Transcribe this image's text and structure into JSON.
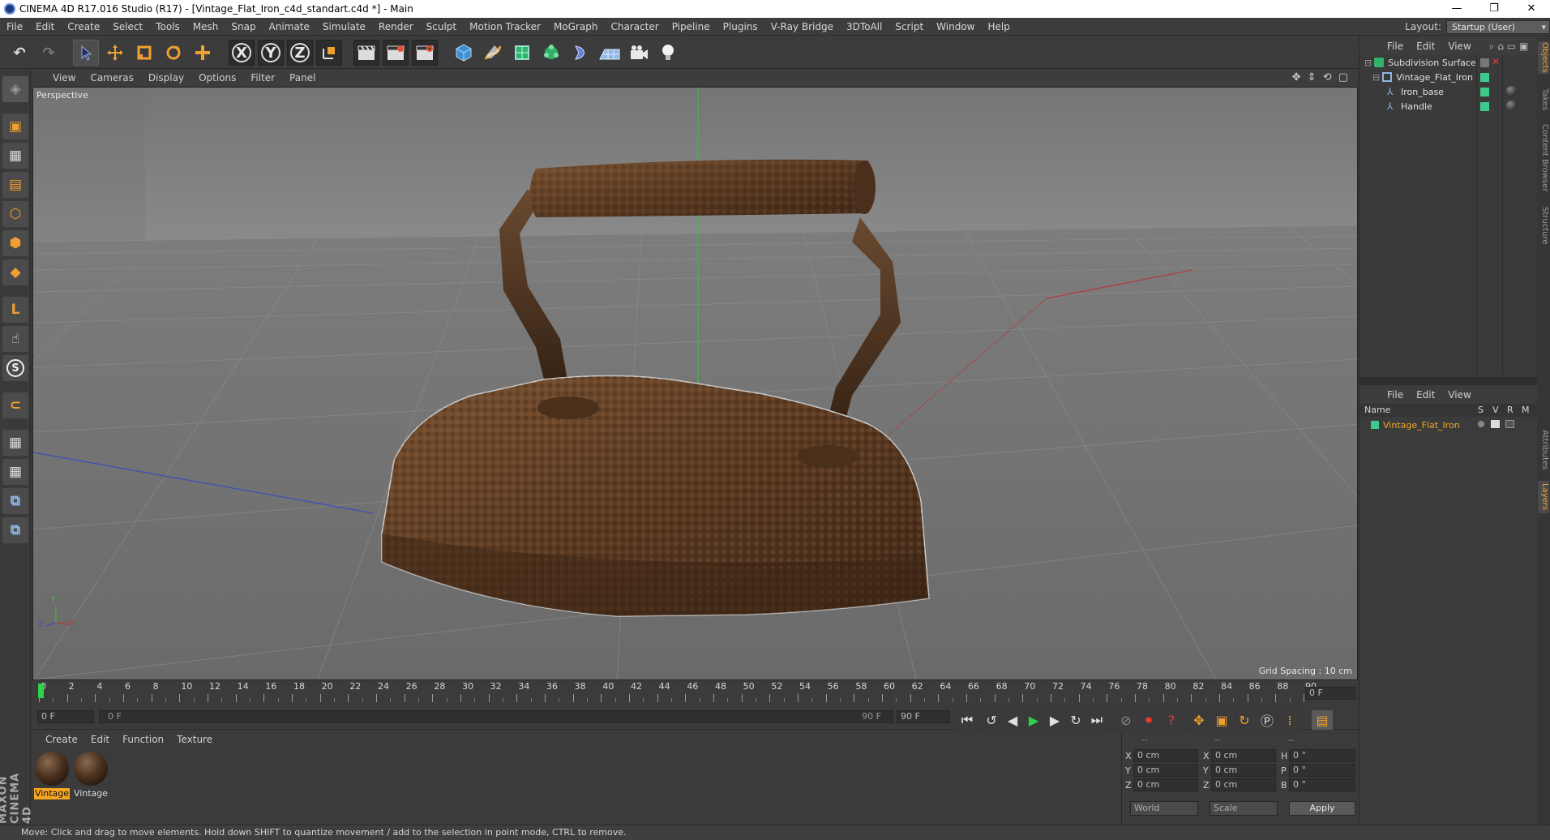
{
  "window": {
    "title": "CINEMA 4D R17.016 Studio (R17) - [Vintage_Flat_Iron_c4d_standart.c4d *] - Main",
    "minimize": "—",
    "restore": "❐",
    "close": "✕"
  },
  "menubar": {
    "items": [
      "File",
      "Edit",
      "Create",
      "Select",
      "Tools",
      "Mesh",
      "Snap",
      "Animate",
      "Simulate",
      "Render",
      "Sculpt",
      "Motion Tracker",
      "MoGraph",
      "Character",
      "Pipeline",
      "Plugins",
      "V-Ray Bridge",
      "3DToAll",
      "Script",
      "Window",
      "Help"
    ],
    "layout_label": "Layout:",
    "layout_value": "Startup (User)"
  },
  "toolbar": {
    "undo": "↶",
    "redo": "↷",
    "x_axis": "X",
    "y_axis": "Y",
    "z_axis": "Z"
  },
  "viewport": {
    "menu": [
      "View",
      "Cameras",
      "Display",
      "Options",
      "Filter",
      "Panel"
    ],
    "nav_icons": "✥ ⇕ ⟲ ▢",
    "label": "Perspective",
    "grid_spacing": "Grid Spacing : 10 cm",
    "axis_y": "Y",
    "axis_x": "X",
    "axis_z": "Z"
  },
  "timeline": {
    "ticks": [
      "0",
      "2",
      "4",
      "6",
      "8",
      "10",
      "12",
      "14",
      "16",
      "18",
      "20",
      "22",
      "24",
      "26",
      "28",
      "30",
      "32",
      "34",
      "36",
      "38",
      "40",
      "42",
      "44",
      "46",
      "48",
      "50",
      "52",
      "54",
      "56",
      "58",
      "60",
      "62",
      "64",
      "66",
      "68",
      "70",
      "72",
      "74",
      "76",
      "78",
      "80",
      "82",
      "84",
      "86",
      "88",
      "90"
    ],
    "current_frame": "0 F",
    "start_frame": "0 F",
    "range_start": "0 F",
    "range_end": "90 F",
    "end_frame": "90 F",
    "playhead_fraction": 0.0
  },
  "materials": {
    "menu": [
      "Create",
      "Edit",
      "Function",
      "Texture"
    ],
    "items": [
      {
        "name": "Vintage",
        "selected": true
      },
      {
        "name": "Vintage",
        "selected": false
      }
    ]
  },
  "coordinates": {
    "header": [
      "--",
      "--",
      "--"
    ],
    "rows": [
      {
        "axis": "X",
        "pos": "0 cm",
        "size_axis": "X",
        "size": "0 cm",
        "rot_axis": "H",
        "rot": "0 °"
      },
      {
        "axis": "Y",
        "pos": "0 cm",
        "size_axis": "Y",
        "size": "0 cm",
        "rot_axis": "P",
        "rot": "0 °"
      },
      {
        "axis": "Z",
        "pos": "0 cm",
        "size_axis": "Z",
        "size": "0 cm",
        "rot_axis": "B",
        "rot": "0 °"
      }
    ],
    "mode_world": "World",
    "mode_scale": "Scale",
    "apply": "Apply"
  },
  "object_manager": {
    "menu": [
      "File",
      "Edit",
      "View"
    ],
    "objects": [
      "Subdivision Surface",
      "Vintage_Flat_Iron",
      "Iron_base",
      "Handle"
    ]
  },
  "layer_manager": {
    "menu": [
      "File",
      "Edit",
      "View"
    ],
    "columns": [
      "Name",
      "S",
      "V",
      "R",
      "M"
    ],
    "layer": "Vintage_Flat_Iron"
  },
  "side_tabs": [
    "Objects",
    "Takes",
    "Content Browser",
    "Structure",
    "Attributes",
    "Layers"
  ],
  "status": "Move: Click and drag to move elements. Hold down SHIFT to quantize movement / add to the selection in point mode, CTRL to remove.",
  "brand": "MAXON CINEMA 4D",
  "colors": {
    "accent": "#f0a030",
    "layer_green": "#3ec98a",
    "selected_orange": "#f5a623"
  }
}
